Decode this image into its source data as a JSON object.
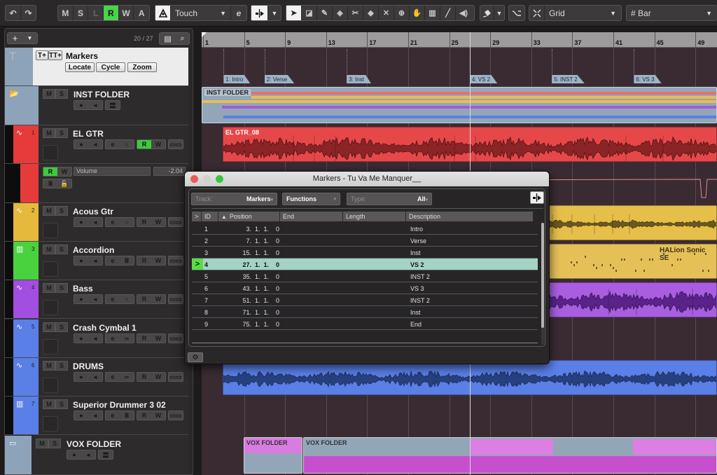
{
  "toolbar": {
    "undo_icon": "undo-icon",
    "redo_icon": "redo-icon",
    "state_buttons": [
      {
        "label": "M",
        "active": false
      },
      {
        "label": "S",
        "active": false
      },
      {
        "label": "L",
        "active": false,
        "dim": true
      },
      {
        "label": "R",
        "active": true
      },
      {
        "label": "W",
        "active": false
      },
      {
        "label": "A",
        "active": false
      }
    ],
    "automation_mode": "Touch",
    "snap_type": "Grid",
    "grid_type": "Bar",
    "tools": [
      "object-select-icon",
      "range-select-icon",
      "split-pencil-icon",
      "eraser-icon",
      "scissors-icon",
      "glue-icon",
      "mute-x-icon",
      "zoom-icon",
      "hand-icon",
      "comp-icon",
      "line-icon",
      "speaker-icon"
    ]
  },
  "tracklist": {
    "add_label": "+",
    "count": "20 / 27",
    "tracks": [
      {
        "type": "marker",
        "name": "Markers",
        "buttons": [
          "Locate",
          "Cycle",
          "Zoom"
        ]
      },
      {
        "type": "folder",
        "name": "INST FOLDER"
      },
      {
        "type": "audio",
        "num": "1",
        "name": "EL GTR",
        "color": "#e53b3b",
        "read_on": true
      },
      {
        "type": "automation",
        "param": "Volume",
        "value": "-2.04"
      },
      {
        "type": "audio",
        "num": "2",
        "name": "Acous Gtr",
        "color": "#e5b93c"
      },
      {
        "type": "instrument",
        "num": "3",
        "name": "Accordion",
        "color": "#4ad23e"
      },
      {
        "type": "audio",
        "num": "4",
        "name": "Bass",
        "color": "#a24ee0"
      },
      {
        "type": "audio",
        "num": "5",
        "name": "Crash Cymbal 1",
        "color": "#5a7fe6"
      },
      {
        "type": "audio",
        "num": "6",
        "name": "DRUMS",
        "color": "#5a7fe6"
      },
      {
        "type": "instrument",
        "num": "7",
        "name": "Superior Drummer 3 02",
        "color": "#5a7fe6"
      },
      {
        "type": "folder",
        "name": "VOX FOLDER"
      }
    ],
    "labels": {
      "m": "M",
      "s": "S",
      "r": "R",
      "w": "W"
    }
  },
  "ruler": {
    "bars": [
      "1",
      "5",
      "9",
      "13",
      "17",
      "21",
      "25",
      "29",
      "33",
      "37",
      "41",
      "45",
      "49"
    ]
  },
  "markers_lane": [
    {
      "label": "1: Intro",
      "bar": 3
    },
    {
      "label": "2: Verse",
      "bar": 7
    },
    {
      "label": "3: Inst",
      "bar": 15
    },
    {
      "label": "4: VS 2",
      "bar": 27
    },
    {
      "label": "5: INST 2",
      "bar": 35
    },
    {
      "label": "6: VS 3",
      "bar": 43
    }
  ],
  "events": {
    "inst_folder": "INST FOLDER",
    "el_gtr": "EL GTR_08",
    "accordion": "HALion Sonic SE",
    "vox_folder_1": "VOX FOLDER",
    "vox_folder_2": "VOX FOLDER"
  },
  "colors": {
    "red": "#e53b3b",
    "yellow": "#e5b93c",
    "green": "#4ad23e",
    "purple": "#a24ee0",
    "blue": "#5a7fe6",
    "magenta": "#d14fd6",
    "folder": "#9aa8b8",
    "accent_green": "#4cd24c"
  },
  "dialog": {
    "title": "Markers - Tu Va Me Manquer__",
    "track_label": "Track:",
    "track_value": "Markers",
    "functions_label": "Functions",
    "type_label": "Type:",
    "type_value": "All",
    "columns": [
      ">",
      "ID",
      "Position",
      "End",
      "Length",
      "Description"
    ],
    "sort_column": "Position",
    "rows": [
      {
        "id": "1",
        "position": "3.  1.  1.    0",
        "end": "",
        "length": "",
        "description": "Intro"
      },
      {
        "id": "2",
        "position": "7.  1.  1.    0",
        "end": "",
        "length": "",
        "description": "Verse"
      },
      {
        "id": "3",
        "position": "15.  1.  1.    0",
        "end": "",
        "length": "",
        "description": "Inst"
      },
      {
        "id": "4",
        "position": "27.  1.  1.    0",
        "end": "",
        "length": "",
        "description": "VS 2",
        "selected": true
      },
      {
        "id": "5",
        "position": "35.  1.  1.    0",
        "end": "",
        "length": "",
        "description": "INST 2"
      },
      {
        "id": "6",
        "position": "43.  1.  1.    0",
        "end": "",
        "length": "",
        "description": "VS 3"
      },
      {
        "id": "7",
        "position": "51.  1.  1.    0",
        "end": "",
        "length": "",
        "description": "INST 2"
      },
      {
        "id": "8",
        "position": "71.  1.  1.    0",
        "end": "",
        "length": "",
        "description": "Inst"
      },
      {
        "id": "9",
        "position": "75.  1.  1.    0",
        "end": "",
        "length": "",
        "description": "End"
      }
    ],
    "current_indicator": ">"
  }
}
